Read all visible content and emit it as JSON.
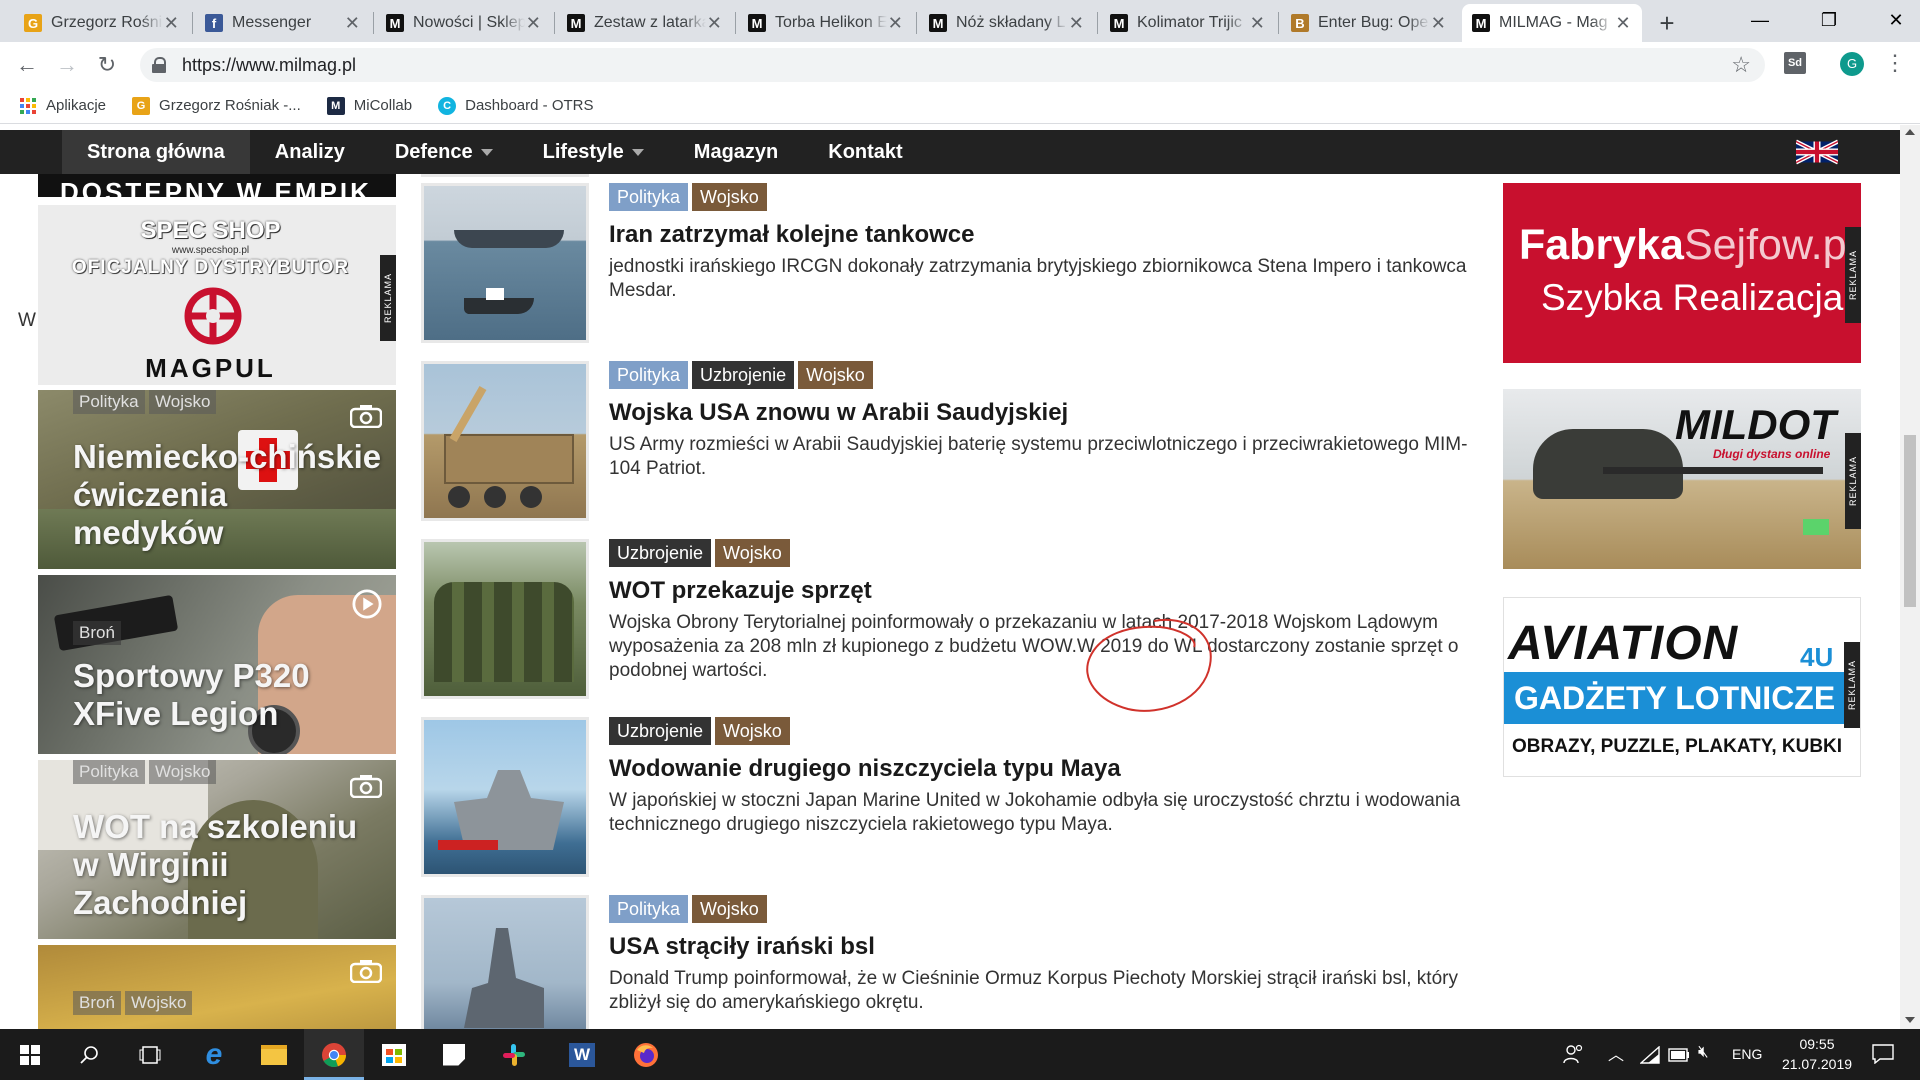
{
  "browser": {
    "tabs": [
      {
        "label": "Grzegorz Rośniak",
        "favicon": "rossi-icon",
        "color": "#e8a317"
      },
      {
        "label": "Messenger",
        "favicon": "facebook-icon",
        "color": "#3b5998"
      },
      {
        "label": "Nowości | Sklep",
        "favicon": "milmag-icon",
        "color": "#111111"
      },
      {
        "label": "Zestaw z latarką",
        "favicon": "milmag-icon",
        "color": "#111111"
      },
      {
        "label": "Torba Helikon E",
        "favicon": "milmag-icon",
        "color": "#111111"
      },
      {
        "label": "Nóż składany L",
        "favicon": "milmag-icon",
        "color": "#111111"
      },
      {
        "label": "Kolimator Trijic",
        "favicon": "milmag-icon",
        "color": "#111111"
      },
      {
        "label": "Enter Bug: Ope",
        "favicon": "bugzilla-icon",
        "color": "#b07a2a"
      },
      {
        "label": "MILMAG - Mag",
        "favicon": "milmag-icon",
        "color": "#111111",
        "active": true
      }
    ],
    "url": "https://www.milmag.pl",
    "profile_initial": "G",
    "extension_label": "Sd",
    "bookmarks": [
      {
        "label": "Aplikacje",
        "icon": "apps-grid-icon"
      },
      {
        "label": "Grzegorz Rośniak -...",
        "icon": "rossi-icon",
        "color": "#e8a317"
      },
      {
        "label": "MiCollab",
        "icon": "micollab-icon",
        "color": "#1d2a44"
      },
      {
        "label": "Dashboard - OTRS",
        "icon": "otrs-icon",
        "color": "#11b4e0"
      }
    ]
  },
  "site": {
    "nav": [
      {
        "label": "Strona główna",
        "active": true
      },
      {
        "label": "Analizy"
      },
      {
        "label": "Defence",
        "dropdown": true
      },
      {
        "label": "Lifestyle",
        "dropdown": true
      },
      {
        "label": "Magazyn"
      },
      {
        "label": "Kontakt"
      }
    ],
    "left_promo": {
      "shop_name": "SPEC SHOP",
      "shop_url": "www.specshop.pl",
      "distributor_line": "OFICJALNY DYSTRYBUTOR",
      "brand": "MAGPUL",
      "ad_label": "REKLAMA",
      "top_banner_text": "DOSTĘPNY W EMPIK"
    },
    "stray_letter": "W",
    "left_cards": [
      {
        "tags": [
          "Polityka",
          "Wojsko"
        ],
        "title_lines": [
          "Niemiecko-chińskie",
          "ćwiczenia",
          "medyków"
        ],
        "media": "camera-icon"
      },
      {
        "tags": [
          "Broń"
        ],
        "title_lines": [
          "Sportowy P320",
          "XFive Legion"
        ],
        "media": "play-icon"
      },
      {
        "tags": [
          "Polityka",
          "Wojsko"
        ],
        "title_lines": [
          "WOT na szkoleniu",
          "w Wirginii",
          "Zachodniej"
        ],
        "media": "camera-icon"
      },
      {
        "tags": [
          "Broń",
          "Wojsko"
        ],
        "title_lines": [],
        "media": "camera-icon"
      }
    ],
    "articles": [
      {
        "tags": [
          {
            "label": "Polityka",
            "color": "#7f9fc8"
          },
          {
            "label": "Wojsko",
            "color": "#7a5a3a"
          }
        ],
        "title": "Iran zatrzymał kolejne tankowce",
        "desc": "jednostki irańskiego IRCGN dokonały zatrzymania brytyjskiego zbiornikowca Stena Impero i tankowca Mesdar."
      },
      {
        "tags": [
          {
            "label": "Polityka",
            "color": "#7f9fc8"
          },
          {
            "label": "Uzbrojenie",
            "color": "#333333"
          },
          {
            "label": "Wojsko",
            "color": "#7a5a3a"
          }
        ],
        "title": "Wojska USA znowu w Arabii Saudyjskiej",
        "desc": "US Army rozmieści w Arabii Saudyjskiej baterię systemu przeciwlotniczego i przeciwrakietowego MIM-104 Patriot."
      },
      {
        "tags": [
          {
            "label": "Uzbrojenie",
            "color": "#333333"
          },
          {
            "label": "Wojsko",
            "color": "#7a5a3a"
          }
        ],
        "title": "WOT przekazuje sprzęt",
        "desc": "Wojska Obrony Terytorialnej poinformowały o przekazaniu w latach 2017-2018 Wojskom Lądowym wyposażenia za 208 mln zł kupionego z budżetu WOW.W 2019 do WL dostarczony zostanie sprzęt o podobnej wartości."
      },
      {
        "tags": [
          {
            "label": "Uzbrojenie",
            "color": "#333333"
          },
          {
            "label": "Wojsko",
            "color": "#7a5a3a"
          }
        ],
        "title": "Wodowanie drugiego niszczyciela typu Maya",
        "desc": "W japońskiej w stoczni Japan Marine United w Jokohamie odbyła się uroczystość chrztu i wodowania technicznego drugiego niszczyciela rakietowego typu Maya."
      },
      {
        "tags": [
          {
            "label": "Polityka",
            "color": "#7f9fc8"
          },
          {
            "label": "Wojsko",
            "color": "#7a5a3a"
          }
        ],
        "title": "USA strąciły irański bsl",
        "desc": "Donald Trump poinformował, że w Cieśninie Ormuz Korpus Piechoty Morskiej strącił irański bsl, który zbliżył się do amerykańskiego okrętu."
      }
    ],
    "ads": [
      {
        "line1_a": "Fabryka",
        "line1_b": "Sejfow.pl",
        "line2": "Szybka Realizacja",
        "label": "REKLAMA",
        "bg": "#c8102e"
      },
      {
        "brand": "MILDOT",
        "tagline": "Długi dystans online",
        "label": "REKLAMA"
      },
      {
        "brand": "AVIATION",
        "brand_suffix": "4U",
        "line2": "GADŻETY LOTNICZE",
        "line3": "OBRAZY, PUZZLE, PLAKATY, KUBKI",
        "label": "REKLAMA"
      }
    ]
  },
  "taskbar": {
    "language": "ENG",
    "time": "09:55",
    "date": "21.07.2019"
  }
}
